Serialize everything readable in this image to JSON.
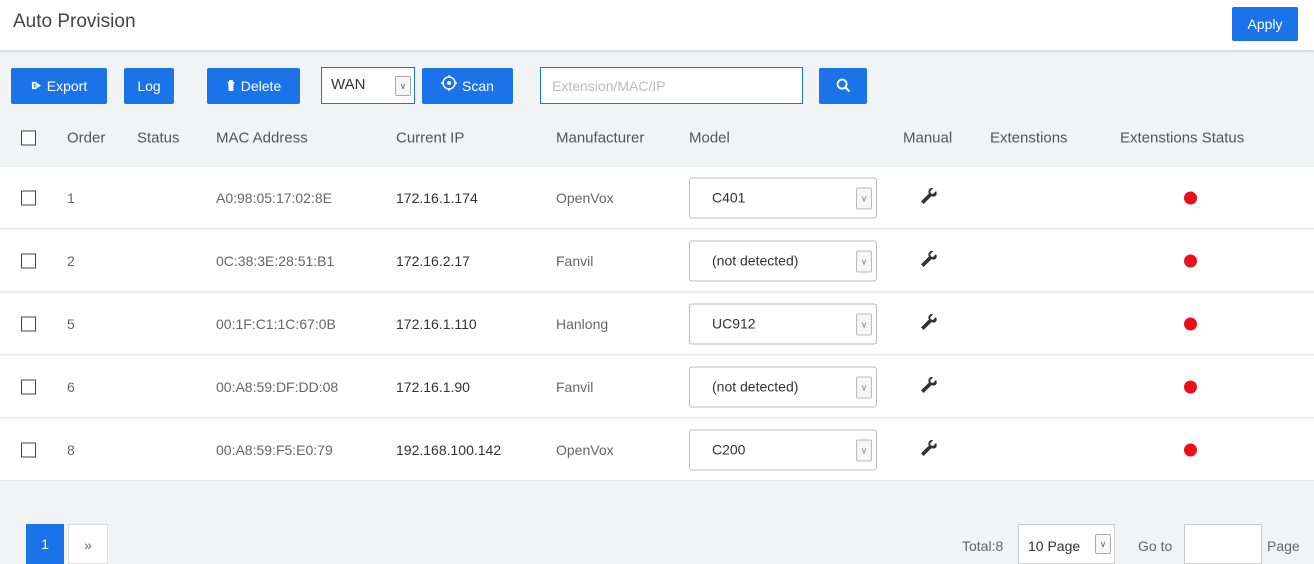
{
  "header": {
    "title": "Auto Provision",
    "apply_label": "Apply"
  },
  "toolbar": {
    "export_label": "Export",
    "log_label": "Log",
    "delete_label": "Delete",
    "network": "WAN",
    "scan_label": "Scan",
    "search_placeholder": "Extension/MAC/IP",
    "accent_color": "#1a73e8"
  },
  "columns": [
    "Order",
    "Status",
    "MAC Address",
    "Current IP",
    "Manufacturer",
    "Model",
    "Manual",
    "Extenstions",
    "Extenstions Status"
  ],
  "rows": [
    {
      "order": "1",
      "status": "",
      "mac": "A0:98:05:17:02:8E",
      "ip": "172.16.1.174",
      "manufacturer": "OpenVox",
      "model": "C401",
      "extensions": "",
      "ext_status": "offline"
    },
    {
      "order": "2",
      "status": "",
      "mac": "0C:38:3E:28:51:B1",
      "ip": "172.16.2.17",
      "manufacturer": "Fanvil",
      "model": "(not detected)",
      "extensions": "",
      "ext_status": "offline"
    },
    {
      "order": "5",
      "status": "",
      "mac": "00:1F:C1:1C:67:0B",
      "ip": "172.16.1.110",
      "manufacturer": "Hanlong",
      "model": "UC912",
      "extensions": "",
      "ext_status": "offline"
    },
    {
      "order": "6",
      "status": "",
      "mac": "00:A8:59:DF:DD:08",
      "ip": "172.16.1.90",
      "manufacturer": "Fanvil",
      "model": "(not detected)",
      "extensions": "",
      "ext_status": "offline"
    },
    {
      "order": "8",
      "status": "",
      "mac": "00:A8:59:F5:E0:79",
      "ip": "192.168.100.142",
      "manufacturer": "OpenVox",
      "model": "C200",
      "extensions": "",
      "ext_status": "offline"
    }
  ],
  "pagination": {
    "current_page": "1",
    "next_label": "»",
    "total_label": "Total:8",
    "page_size": "10 Page",
    "goto_label": "Go to",
    "page_suffix": "Page"
  },
  "icons": {
    "export": "export-icon",
    "delete": "trash-icon",
    "scan": "scan-target-icon",
    "search": "search-icon",
    "manual": "wrench-icon"
  },
  "status_colors": {
    "offline": "#e8111a"
  }
}
